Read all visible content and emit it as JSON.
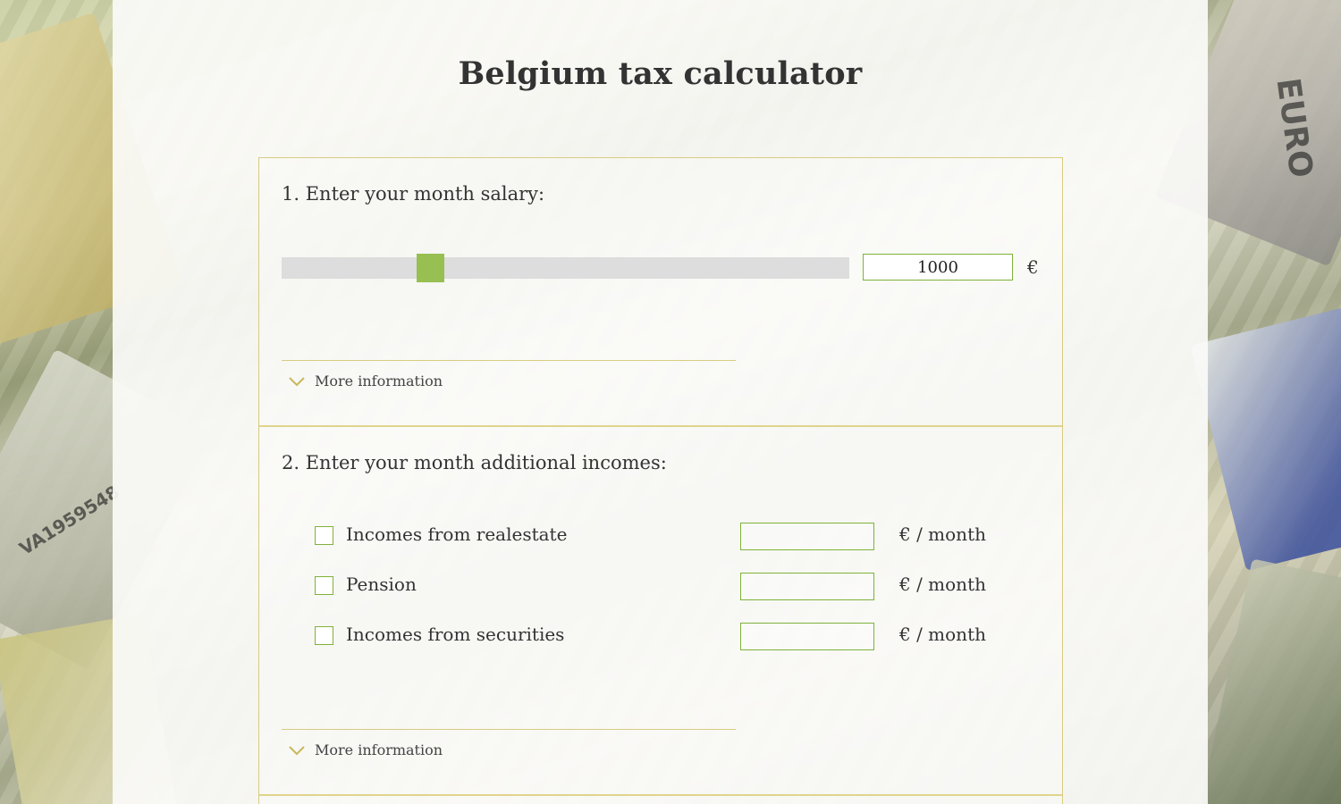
{
  "page": {
    "title": "Belgium tax calculator"
  },
  "background": {
    "banknote_texts": [
      "EURO",
      "VA1959548"
    ]
  },
  "section1": {
    "title": "1. Enter your month salary:",
    "salary_value": "1000",
    "slider_level_fraction": 0.262,
    "currency": "€",
    "more_info_label": "More information"
  },
  "section2": {
    "title": "2. Enter your month additional incomes:",
    "incomes": [
      {
        "label": "Incomes from realestate",
        "value": "",
        "unit": "€ / month",
        "checked": false
      },
      {
        "label": "Pension",
        "value": "",
        "unit": "€ / month",
        "checked": false
      },
      {
        "label": "Incomes from securities",
        "value": "",
        "unit": "€ / month",
        "checked": false
      }
    ],
    "more_info_label": "More information"
  },
  "colors": {
    "accent_green": "#97bf52",
    "input_border": "#7fb23a",
    "card_border": "#d8cc80",
    "text": "#333333"
  }
}
